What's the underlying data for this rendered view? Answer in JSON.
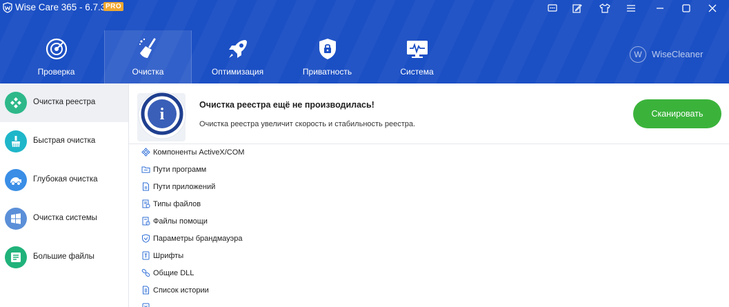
{
  "window": {
    "title": "Wise Care 365 - 6.7.3",
    "badge": "PRO",
    "controls": [
      "feedback-icon",
      "edit-icon",
      "skin-icon",
      "menu-icon",
      "minimize-icon",
      "maximize-icon",
      "close-icon"
    ]
  },
  "tabs": [
    {
      "label": "Проверка",
      "icon": "radar-icon",
      "active": false
    },
    {
      "label": "Очистка",
      "icon": "broom-icon",
      "active": true
    },
    {
      "label": "Оптимизация",
      "icon": "rocket-icon",
      "active": false
    },
    {
      "label": "Приватность",
      "icon": "shield-lock-icon",
      "active": false
    },
    {
      "label": "Система",
      "icon": "monitor-icon",
      "active": false
    }
  ],
  "brand": {
    "letter": "W",
    "name": "WiseCleaner"
  },
  "sidebar": {
    "items": [
      {
        "label": "Очистка реестра",
        "icon": "registry-icon",
        "color": "#2eb88a",
        "active": true
      },
      {
        "label": "Быстрая очистка",
        "icon": "quick-clean-icon",
        "color": "#1fb6c9",
        "active": false
      },
      {
        "label": "Глубокая очистка",
        "icon": "deep-clean-icon",
        "color": "#3a8ee6",
        "active": false
      },
      {
        "label": "Очистка системы",
        "icon": "windows-icon",
        "color": "#5b8fd8",
        "active": false
      },
      {
        "label": "Большие файлы",
        "icon": "big-files-icon",
        "color": "#20b27a",
        "active": false
      }
    ]
  },
  "banner": {
    "title": "Очистка реестра ещё не производилась!",
    "subtitle": "Очистка реестра увеличит скорость и стабильность реестра.",
    "scan_label": "Сканировать"
  },
  "list": {
    "items": [
      {
        "label": "Компоненты ActiveX/COM",
        "icon": "activex-icon"
      },
      {
        "label": "Пути программ",
        "icon": "folder-icon"
      },
      {
        "label": "Пути приложений",
        "icon": "document-icon"
      },
      {
        "label": "Типы файлов",
        "icon": "file-types-icon"
      },
      {
        "label": "Файлы помощи",
        "icon": "help-file-icon"
      },
      {
        "label": "Параметры брандмауэра",
        "icon": "firewall-icon"
      },
      {
        "label": "Шрифты",
        "icon": "font-icon"
      },
      {
        "label": "Общие DLL",
        "icon": "link-icon"
      },
      {
        "label": "Список истории",
        "icon": "history-icon"
      }
    ]
  },
  "colors": {
    "header": "#1b4fc4",
    "accent_green": "#3bb33b",
    "badge": "#f0a830",
    "icon_blue": "#2f6fd6"
  }
}
